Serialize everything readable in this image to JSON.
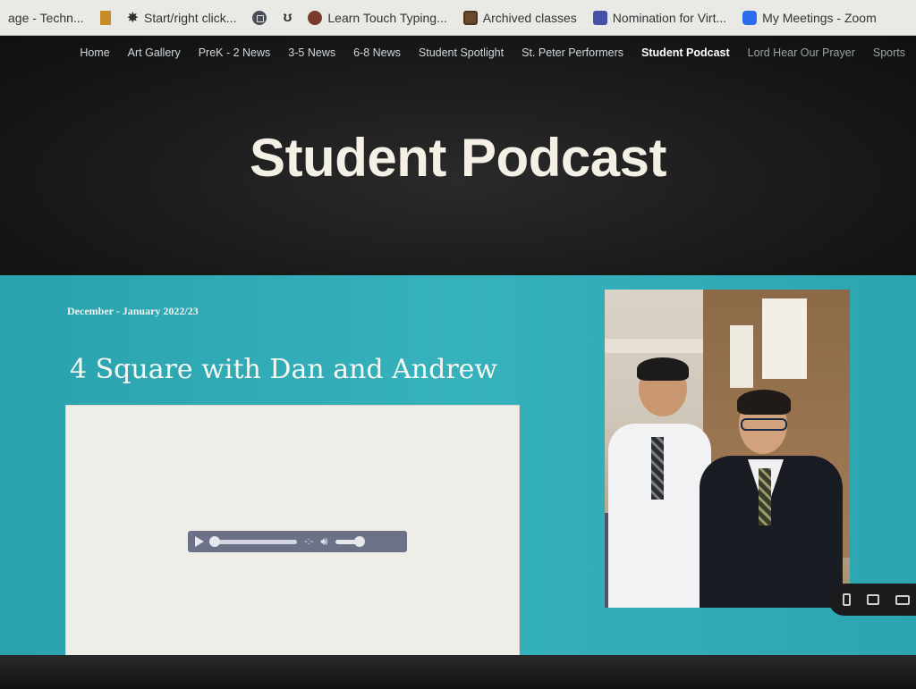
{
  "bookmarks": [
    {
      "label": "age - Techn...",
      "icon": "page-icon"
    },
    {
      "label": "",
      "icon": "document-icon"
    },
    {
      "label": "Start/right click...",
      "icon": "sparkle-icon"
    },
    {
      "label": "",
      "icon": "app-circle-icon"
    },
    {
      "label": "",
      "icon": "hook-icon"
    },
    {
      "label": "Learn Touch Typing...",
      "icon": "avatar-icon"
    },
    {
      "label": "Archived classes",
      "icon": "classroom-icon"
    },
    {
      "label": "Nomination for Virt...",
      "icon": "forms-icon"
    },
    {
      "label": "My Meetings - Zoom",
      "icon": "zoom-icon"
    }
  ],
  "nav": [
    "Home",
    "Art Gallery",
    "PreK - 2 News",
    "3-5 News",
    "6-8 News",
    "Student Spotlight",
    "St. Peter Performers",
    "Student Podcast",
    "Lord Hear Our Prayer",
    "Sports"
  ],
  "page": {
    "title": "Student Podcast",
    "date": "December - January 2022/23",
    "post_title": "4 Square with Dan and Andrew"
  },
  "player": {
    "progress": 0,
    "volume": 1.0,
    "icons": [
      "play-icon",
      "loop-icon",
      "volume-icon"
    ]
  },
  "device_preview": [
    "phone-icon",
    "tablet-icon",
    "desktop-icon"
  ],
  "colors": {
    "content_bg": "#2ea8b3",
    "header_bg": "#161616",
    "player_bg": "#6b7187"
  }
}
